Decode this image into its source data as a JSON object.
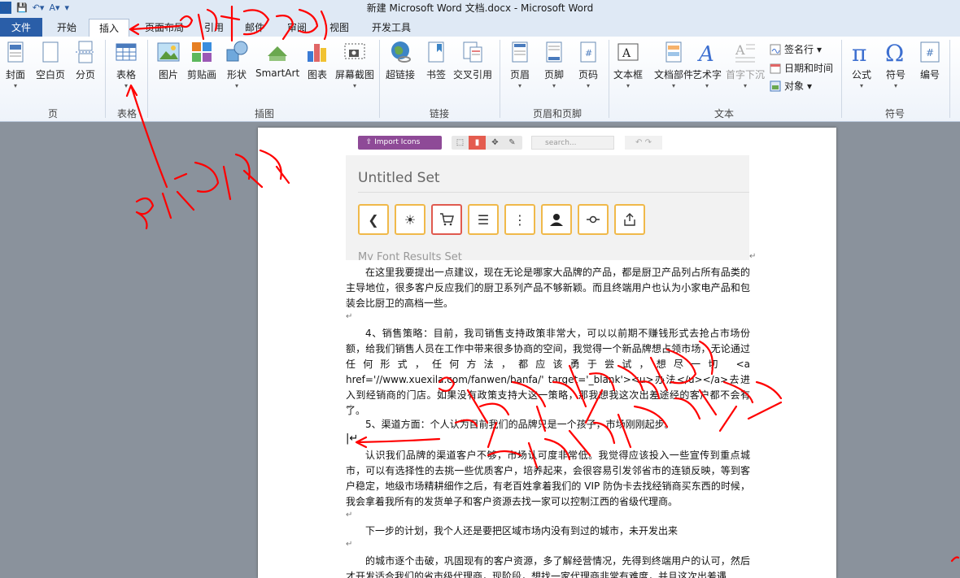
{
  "window": {
    "title": "新建 Microsoft Word 文档.docx - Microsoft Word"
  },
  "quick_access": {
    "logo": "W",
    "save": "save-icon",
    "undo": "undo-icon",
    "redo": "redo-icon"
  },
  "tabs": [
    {
      "label": "文件"
    },
    {
      "label": "开始"
    },
    {
      "label": "插入"
    },
    {
      "label": "页面布局"
    },
    {
      "label": "引用"
    },
    {
      "label": "邮件"
    },
    {
      "label": "审阅"
    },
    {
      "label": "视图"
    },
    {
      "label": "开发工具"
    }
  ],
  "active_tab": "插入",
  "ribbon": {
    "pages": {
      "cover": "封面",
      "blank": "空白页",
      "break": "分页",
      "group": "页"
    },
    "tables": {
      "table": "表格",
      "group": "表格"
    },
    "illustrations": {
      "picture": "图片",
      "clipart": "剪贴画",
      "shapes": "形状",
      "smartart": "SmartArt",
      "chart": "图表",
      "screenshot": "屏幕截图",
      "group": "插图"
    },
    "links": {
      "hyperlink": "超链接",
      "bookmark": "书签",
      "crossref": "交叉引用",
      "group": "链接"
    },
    "header_footer": {
      "header": "页眉",
      "footer": "页脚",
      "pagenum": "页码",
      "group": "页眉和页脚"
    },
    "text": {
      "textbox": "文本框",
      "quickparts": "文档部件",
      "wordart": "艺术字",
      "dropcap": "首字下沉",
      "signature": "签名行",
      "datetime": "日期和时间",
      "object": "对象",
      "group": "文本"
    },
    "symbols": {
      "equation": "公式",
      "symbol": "符号",
      "number": "编号",
      "group": "符号"
    }
  },
  "embedded_screenshot": {
    "import_label": "Import Icons",
    "search_placeholder": "search...",
    "set_title": "Untitled Set",
    "next_set": "My Font Results Set",
    "icons": [
      "chevron-left-icon",
      "sun-icon",
      "cart-icon",
      "menu-icon",
      "more-vertical-icon",
      "user-icon",
      "commit-icon",
      "share-icon"
    ]
  },
  "document": {
    "p1": "在这里我要提出一点建议，现在无论是哪家大品牌的产品，都是厨卫产品列占所有品类的主导地位，很多客户反应我们的厨卫系列产品不够新颖。而且终端用户也认为小家电产品和包装会比厨卫的高档一些。",
    "p2": "4、销售策略：目前，我司销售支持政策非常大，可以以前期不赚钱形式去抢占市场份额，给我们销售人员在工作中带来很多协商的空间，我觉得一个新品牌想占领市场，无论通过任何形式，任何方法，都应该勇于尝试，想尽一切 <a href='//www.xuexila.com/fanwen/banfa/' target='_blank'><u>办法</u></a>去进入到经销商的门店。如果没有政策支持大这一策略，那我想我这次出差途经的客户都不会有了。",
    "p3": "5、渠道方面：个人认为目前我们的品牌只是一个孩子，市场刚刚起步。",
    "p4": "认识我们品牌的渠道客户不够，市场认可度非常低。我觉得应该投入一些宣传到重点城市，可以有选择性的去挑一些优质客户，培养起来，会很容易引发邻省市的连锁反映，等到客户稳定，地级市场精耕细作之后，有老百姓拿着我们的 VIP 防伪卡去找经销商买东西的时候，我会拿着我所有的发货单子和客户资源去找一家可以控制江西的省级代理商。",
    "p5": "下一步的计划，我个人还是要把区域市场内没有到过的城市，未开发出来",
    "p6": "的城市逐个击破，巩固现有的客户资源，多了解经营情况，先得到终端用户的认可，然后才开发适合我们的省市级代理商，现阶段，想找一家代理商非常有难度，并且这次出差遇"
  },
  "annotations": {
    "stroke_color": "#ff0000"
  }
}
